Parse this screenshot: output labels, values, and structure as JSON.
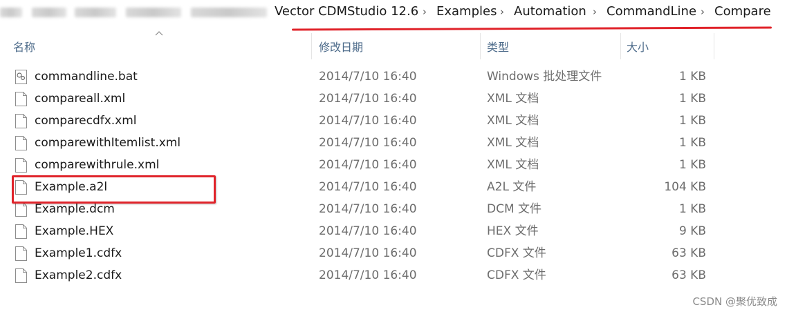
{
  "breadcrumb": {
    "items": [
      "Vector CDMStudio 12.6",
      "Examples",
      "Automation",
      "CommandLine",
      "Compare"
    ],
    "separator": "›"
  },
  "columns": {
    "name": "名称",
    "date": "修改日期",
    "type": "类型",
    "size": "大小"
  },
  "files": [
    {
      "name": "commandline.bat",
      "date": "2014/7/10 16:40",
      "type": "Windows 批处理文件",
      "size": "1 KB",
      "icon": "batch-file-icon"
    },
    {
      "name": "compareall.xml",
      "date": "2014/7/10 16:40",
      "type": "XML 文档",
      "size": "1 KB",
      "icon": "document-icon"
    },
    {
      "name": "comparecdfx.xml",
      "date": "2014/7/10 16:40",
      "type": "XML 文档",
      "size": "1 KB",
      "icon": "document-icon"
    },
    {
      "name": "comparewithItemlist.xml",
      "date": "2014/7/10 16:40",
      "type": "XML 文档",
      "size": "1 KB",
      "icon": "document-icon"
    },
    {
      "name": "comparewithrule.xml",
      "date": "2014/7/10 16:40",
      "type": "XML 文档",
      "size": "1 KB",
      "icon": "document-icon"
    },
    {
      "name": "Example.a2l",
      "date": "2014/7/10 16:40",
      "type": "A2L 文件",
      "size": "104 KB",
      "icon": "document-icon"
    },
    {
      "name": "Example.dcm",
      "date": "2014/7/10 16:40",
      "type": "DCM 文件",
      "size": "1 KB",
      "icon": "document-icon"
    },
    {
      "name": "Example.HEX",
      "date": "2014/7/10 16:40",
      "type": "HEX 文件",
      "size": "9 KB",
      "icon": "document-icon"
    },
    {
      "name": "Example1.cdfx",
      "date": "2014/7/10 16:40",
      "type": "CDFX 文件",
      "size": "63 KB",
      "icon": "document-icon"
    },
    {
      "name": "Example2.cdfx",
      "date": "2014/7/10 16:40",
      "type": "CDFX 文件",
      "size": "63 KB",
      "icon": "document-icon"
    }
  ],
  "watermark": "CSDN @聚优致成",
  "colors": {
    "annotation_red": "#e0232a",
    "header_text": "#4d6b8a"
  }
}
